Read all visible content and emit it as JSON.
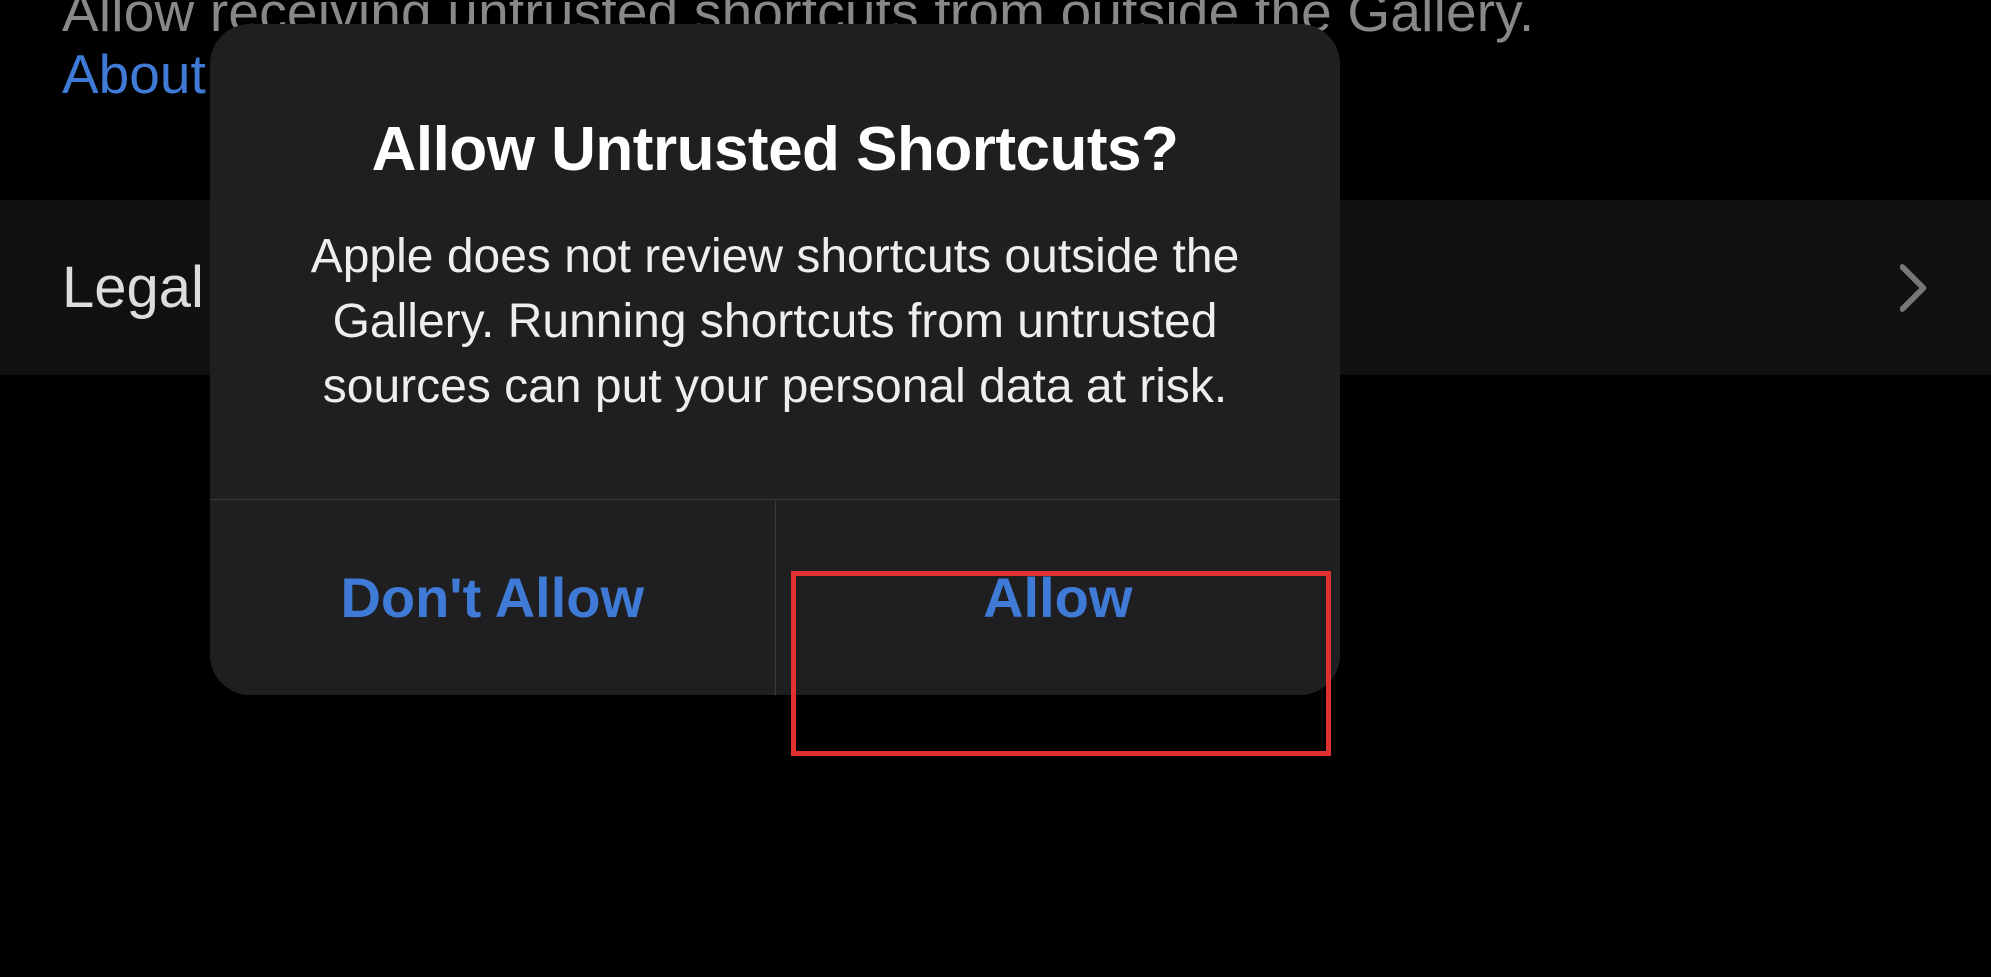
{
  "background": {
    "top_text": "Allow receiving untrusted shortcuts from outside the Gallery.",
    "link_partial": "About S",
    "row_label": "Legal"
  },
  "dialog": {
    "title": "Allow Untrusted Shortcuts?",
    "text": "Apple does not review shortcuts outside the Gallery. Running shortcuts from untrusted sources can put your personal data at risk.",
    "buttons": {
      "deny": "Don't Allow",
      "allow": "Allow"
    }
  },
  "colors": {
    "link_blue": "#3f7bd6",
    "dialog_bg": "#1f1f21",
    "highlight_red": "#e03030"
  }
}
